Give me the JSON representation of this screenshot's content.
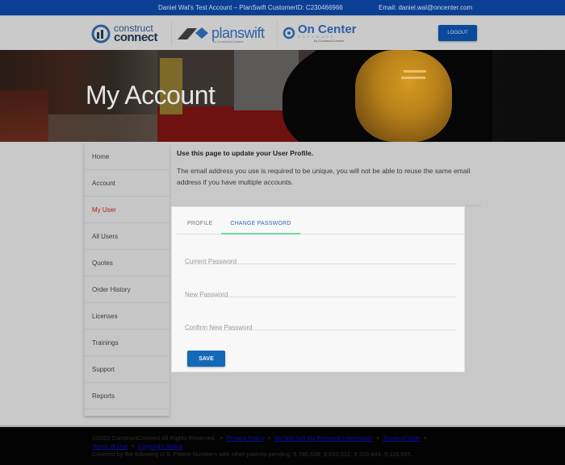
{
  "topbar": {
    "account": "Daniel Wal's Test Account  –  PlanSwift CustomerID: C230466966",
    "email": "Email: daniel.wal@oncenter.com"
  },
  "header": {
    "logos": {
      "constructconnect_top": "construct",
      "constructconnect_bottom": "connect",
      "planswift": "planswift",
      "planswift_sub": "by ConstructConnect",
      "oncenter": "On Center",
      "oncenter_soft": "SOFTWARE",
      "oncenter_by": "by ConstructConnect"
    },
    "logout_label": "LOGOUT"
  },
  "hero": {
    "title": "My Account"
  },
  "sidebar": {
    "active_index": 2,
    "items": [
      {
        "label": "Home"
      },
      {
        "label": "Account"
      },
      {
        "label": "My User"
      },
      {
        "label": "All Users"
      },
      {
        "label": "Quotes"
      },
      {
        "label": "Order History"
      },
      {
        "label": "Licenses"
      },
      {
        "label": "Trainings"
      },
      {
        "label": "Support"
      },
      {
        "label": "Reports"
      }
    ]
  },
  "intro": {
    "lead": "Use this page to update your User Profile.",
    "note": "The email address you use is required to be unique, you will not be able to reuse the same email address if you have multiple accounts."
  },
  "card": {
    "tabs": [
      {
        "label": "PROFILE",
        "active": false
      },
      {
        "label": "CHANGE PASSWORD",
        "active": true
      }
    ],
    "fields": {
      "current_password": {
        "placeholder": "Current Password",
        "value": ""
      },
      "new_password": {
        "placeholder": "New Password",
        "value": ""
      },
      "confirm_password": {
        "placeholder": "Confirm New Password",
        "value": ""
      }
    },
    "save_label": "SAVE"
  },
  "footer": {
    "copyright": "©2023 ConstructConnect All Rights Reserved.",
    "links": {
      "privacy": "Privacy Policy",
      "do_not_sell": "Do Not Sell My Personal Information",
      "terms_sale": "Terms of Sale",
      "terms_use": "Terms of Use",
      "copyright_notice": "Copyright Notice"
    },
    "separator": "•",
    "patents": "Covered by the following U.S. Patent Numbers with other patents pending: 9,785,638; 9,633,012; 9,329,844; 9,116,895."
  },
  "colors": {
    "topbar": "#0b3f93",
    "accent_blue": "#1469b6",
    "active_nav": "#b22222",
    "tab_indicator": "#6edc9c"
  }
}
